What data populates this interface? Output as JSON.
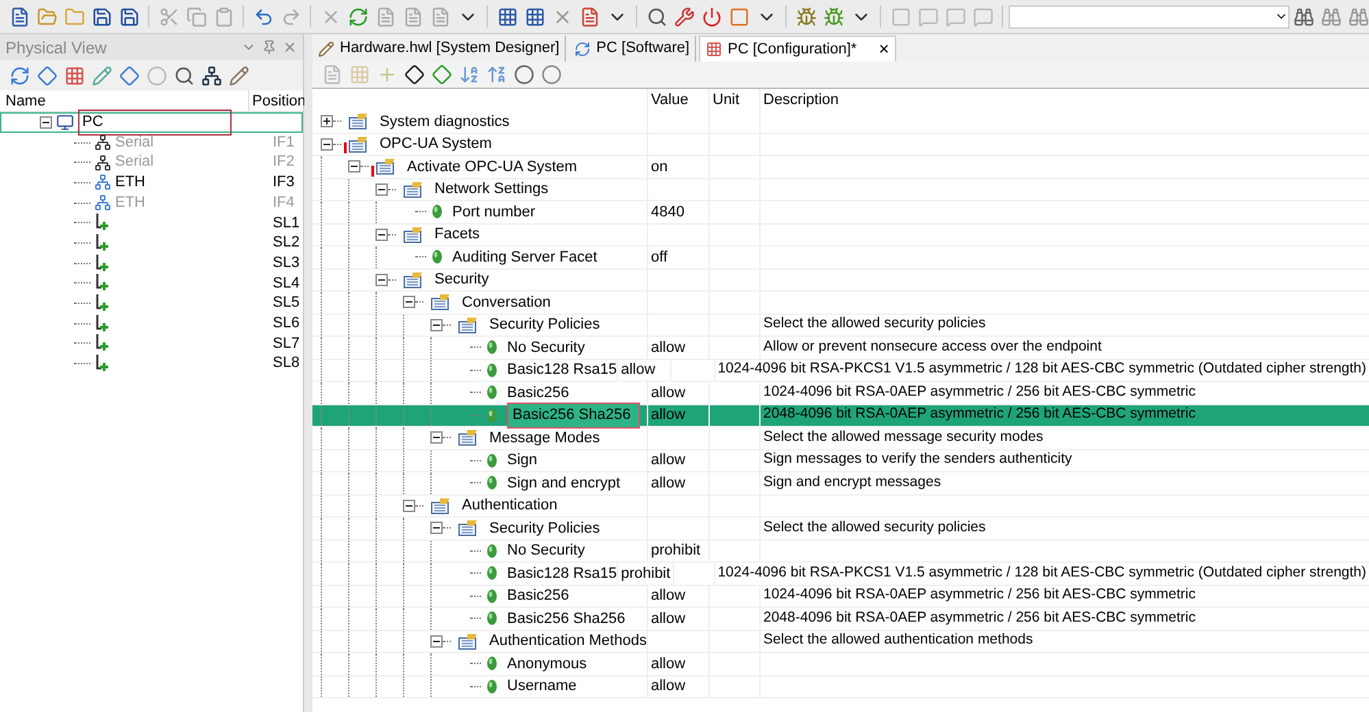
{
  "tabs": [
    {
      "label": "Hardware.hwl [System Designer]",
      "selected": false,
      "kind": "designer"
    },
    {
      "label": "PC [Software]",
      "selected": false,
      "kind": "software"
    },
    {
      "label": "PC [Configuration]*",
      "selected": true,
      "kind": "config",
      "close": "×"
    }
  ],
  "physical_view": {
    "title": "Physical View",
    "columns": [
      "Name",
      "Position"
    ],
    "tree": [
      {
        "label": "PC",
        "kind": "pc",
        "selected": true,
        "expanded": true,
        "disabled": false,
        "children": [
          {
            "label": "Serial",
            "position": "IF1",
            "kind": "serial",
            "selected": false,
            "disabled": true
          },
          {
            "label": "Serial",
            "position": "IF2",
            "kind": "serial",
            "selected": false,
            "disabled": true
          },
          {
            "label": "ETH",
            "position": "IF3",
            "kind": "eth",
            "selected": false,
            "disabled": false
          },
          {
            "label": "ETH",
            "position": "IF4",
            "kind": "eth",
            "selected": false,
            "disabled": true
          },
          {
            "position": "SL1",
            "kind": "slot",
            "selected": false,
            "disabled": false
          },
          {
            "position": "SL2",
            "kind": "slot",
            "selected": false,
            "disabled": false
          },
          {
            "position": "SL3",
            "kind": "slot",
            "selected": false,
            "disabled": false
          },
          {
            "position": "SL4",
            "kind": "slot",
            "selected": false,
            "disabled": false
          },
          {
            "position": "SL5",
            "kind": "slot",
            "selected": false,
            "disabled": false
          },
          {
            "position": "SL6",
            "kind": "slot",
            "selected": false,
            "disabled": false
          },
          {
            "position": "SL7",
            "kind": "slot",
            "selected": false,
            "disabled": false
          },
          {
            "position": "SL8",
            "kind": "slot",
            "selected": false,
            "disabled": false
          }
        ]
      }
    ]
  },
  "configuration": {
    "columns": [
      "Value",
      "Unit",
      "Description"
    ],
    "tree": [
      {
        "kind": "group",
        "label": "System diagnostics",
        "expanded": false,
        "selected": false
      },
      {
        "kind": "group",
        "label": "OPC-UA System",
        "expanded": true,
        "warning": true,
        "selected": false,
        "children": [
          {
            "kind": "group",
            "label": "Activate OPC-UA System",
            "value": "on",
            "expanded": true,
            "warning": true,
            "selected": false,
            "children": [
              {
                "kind": "group",
                "label": "Network Settings",
                "expanded": true,
                "selected": false,
                "children": [
                  {
                    "kind": "param",
                    "label": "Port number",
                    "value": "4840",
                    "selected": false
                  }
                ]
              },
              {
                "kind": "group",
                "label": "Facets",
                "expanded": true,
                "selected": false,
                "children": [
                  {
                    "kind": "param",
                    "label": "Auditing Server Facet",
                    "value": "off",
                    "selected": false
                  }
                ]
              },
              {
                "kind": "group",
                "label": "Security",
                "expanded": true,
                "selected": false,
                "children": [
                  {
                    "kind": "group",
                    "label": "Conversation",
                    "expanded": true,
                    "selected": false,
                    "children": [
                      {
                        "kind": "group",
                        "label": "Security Policies",
                        "description": "Select the allowed security policies",
                        "expanded": true,
                        "selected": false,
                        "children": [
                          {
                            "kind": "param",
                            "label": "No Security",
                            "value": "allow",
                            "description": "Allow or prevent nonsecure access over the endpoint",
                            "selected": false
                          },
                          {
                            "kind": "param",
                            "label": "Basic128 Rsa15",
                            "value": "allow",
                            "description": "1024-4096 bit RSA-PKCS1 V1.5 asymmetric / 128 bit AES-CBC symmetric (Outdated cipher strength)",
                            "selected": false
                          },
                          {
                            "kind": "param",
                            "label": "Basic256",
                            "value": "allow",
                            "description": "1024-4096 bit RSA-0AEP asymmetric / 256 bit AES-CBC symmetric",
                            "selected": false
                          },
                          {
                            "kind": "param",
                            "label": "Basic256 Sha256",
                            "value": "allow",
                            "description": "2048-4096 bit RSA-0AEP asymmetric / 256 bit AES-CBC symmetric",
                            "selected": true
                          }
                        ]
                      },
                      {
                        "kind": "group",
                        "label": "Message Modes",
                        "description": "Select the allowed message security modes",
                        "expanded": true,
                        "selected": false,
                        "children": [
                          {
                            "kind": "param",
                            "label": "Sign",
                            "value": "allow",
                            "description": "Sign messages to verify the senders authenticity",
                            "selected": false
                          },
                          {
                            "kind": "param",
                            "label": "Sign and encrypt",
                            "value": "allow",
                            "description": "Sign and encrypt messages",
                            "selected": false
                          }
                        ]
                      }
                    ]
                  },
                  {
                    "kind": "group",
                    "label": "Authentication",
                    "expanded": true,
                    "selected": false,
                    "children": [
                      {
                        "kind": "group",
                        "label": "Security Policies",
                        "description": "Select the allowed security policies",
                        "expanded": true,
                        "selected": false,
                        "children": [
                          {
                            "kind": "param",
                            "label": "No Security",
                            "value": "prohibit",
                            "selected": false
                          },
                          {
                            "kind": "param",
                            "label": "Basic128 Rsa15",
                            "value": "prohibit",
                            "description": "1024-4096 bit RSA-PKCS1 V1.5 asymmetric / 128 bit AES-CBC symmetric (Outdated cipher strength)",
                            "selected": false
                          },
                          {
                            "kind": "param",
                            "label": "Basic256",
                            "value": "allow",
                            "description": "1024-4096 bit RSA-0AEP asymmetric / 256 bit AES-CBC symmetric",
                            "selected": false
                          },
                          {
                            "kind": "param",
                            "label": "Basic256 Sha256",
                            "value": "allow",
                            "description": "2048-4096 bit RSA-0AEP asymmetric / 256 bit AES-CBC symmetric",
                            "selected": false
                          }
                        ]
                      },
                      {
                        "kind": "group",
                        "label": "Authentication Methods",
                        "description": "Select the allowed authentication methods",
                        "expanded": true,
                        "selected": false,
                        "children": [
                          {
                            "kind": "param",
                            "label": "Anonymous",
                            "value": "allow",
                            "selected": false
                          },
                          {
                            "kind": "param",
                            "label": "Username",
                            "value": "allow",
                            "selected": false
                          }
                        ]
                      }
                    ]
                  }
                ]
              }
            ]
          }
        ]
      }
    ]
  }
}
